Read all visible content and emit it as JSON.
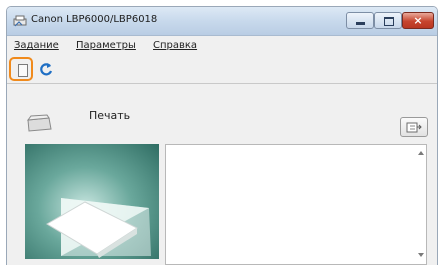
{
  "window": {
    "title": "Canon LBP6000/LBP6018",
    "close_glyph": "×"
  },
  "menu": [
    {
      "label": "Задание"
    },
    {
      "label": "Параметры"
    },
    {
      "label": "Справка"
    }
  ],
  "toolbar": {
    "items": [
      {
        "icon": "document-icon",
        "highlighted": true,
        "highlight_color": "#f08a1c"
      },
      {
        "icon": "refresh-icon",
        "highlighted": false
      }
    ]
  },
  "status": {
    "text": "Печать",
    "icon": "printer-icon"
  },
  "queue_button_icon": "print-queue-icon"
}
